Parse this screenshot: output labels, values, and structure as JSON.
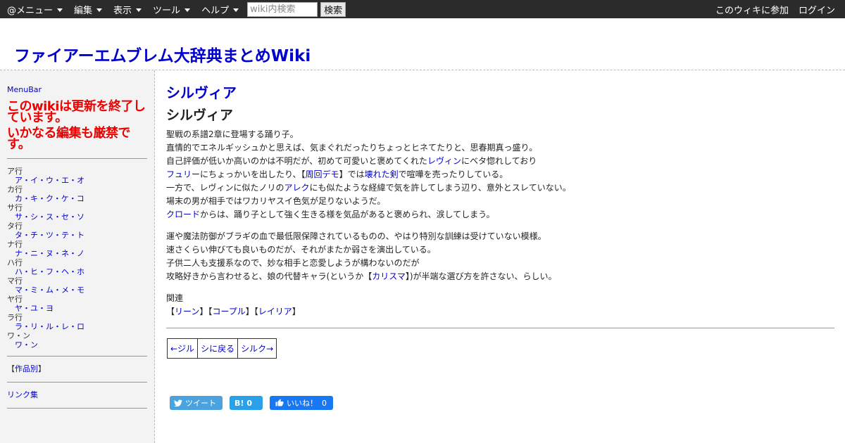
{
  "topbar": {
    "menus": [
      "@メニュー",
      "編集",
      "表示",
      "ツール",
      "ヘルプ"
    ],
    "search_placeholder": "wiki内検索",
    "search_button": "検索",
    "join": "このウィキに参加",
    "login": "ログイン"
  },
  "site_title": "ファイアーエムブレム大辞典まとめWiki",
  "sidebar": {
    "menubar": "MenuBar",
    "warning1": "このwikiは更新を終了しています。",
    "warning2": "いかなる編集も厳禁です。",
    "rows": [
      {
        "head": "ア行",
        "link": "ア・イ・ウ・エ・オ"
      },
      {
        "head": "カ行",
        "link": "カ・キ・ク・ケ・コ"
      },
      {
        "head": "サ行",
        "link": "サ・シ・ス・セ・ソ"
      },
      {
        "head": "タ行",
        "link": "タ・チ・ツ・テ・ト"
      },
      {
        "head": "ナ行",
        "link": "ナ・ニ・ヌ・ネ・ノ"
      },
      {
        "head": "ハ行",
        "link": "ハ・ヒ・フ・ヘ・ホ"
      },
      {
        "head": "マ行",
        "link": "マ・ミ・ム・メ・モ"
      },
      {
        "head": "ヤ行",
        "link": "ヤ・ユ・ヨ"
      },
      {
        "head": "ラ行",
        "link": "ラ・リ・ル・レ・ロ"
      },
      {
        "head": "ワ・ン",
        "link": "ワ・ン"
      }
    ],
    "works_open": "【",
    "works_link": "作品別",
    "works_close": "】",
    "links": "リンク集"
  },
  "main": {
    "page_link": "シルヴィア",
    "heading": "シルヴィア",
    "p1": {
      "l1": "聖戦の系譜2章に登場する踊り子。",
      "l2": "直情的でエネルギッシュかと思えば、気まぐれだったりちょっとヒネてたりと、思春期真っ盛り。",
      "l3a": "自己評価が低いか高いのかは不明だが、初めて可愛いと褒めてくれた",
      "l3link": "レヴィン",
      "l3b": "にベタ惚れしており",
      "l4link1": "フュリー",
      "l4a": "にちょっかいを出したり、【",
      "l4link2": "周回デモ",
      "l4b": "】では",
      "l4link3": "壊れた剣",
      "l4c": "で喧嘩を売ったりしている。",
      "l5a": "一方で、レヴィンに似たノリの",
      "l5link": "アレク",
      "l5b": "にも似たような経緯で気を許してしまう辺り、意外とスレていない。",
      "l6": "場末の男が相手ではワカリヤスイ色気が足りないようだ。",
      "l7link": "クロード",
      "l7a": "からは、踊り子として強く生きる様を気品があると褒められ、涙してしまう。"
    },
    "p2": {
      "l1": "運や魔法防御がブラギの血で最低限保障されているものの、やはり特別な訓練は受けていない模様。",
      "l2": "速さくらい伸びても良いものだが、それがまたか弱さを演出している。",
      "l3": "子供二人も支援系なので、妙な相手と恋愛しようが構わないのだが",
      "l4a": "攻略好きから言わせると、娘の代替キャラ(というか【",
      "l4link": "カリスマ",
      "l4b": "】)が半端な選び方を許さない、らしい。"
    },
    "related": {
      "label": "関連",
      "items": [
        "リーン",
        "コープル",
        "レイリア"
      ]
    },
    "nav": {
      "prev": "←ジル",
      "up": "シに戻る",
      "next": "シルク→"
    },
    "social": {
      "tweet": "ツイート",
      "hatena_icon": "B!",
      "hatena_count": "0",
      "like": "いいね！",
      "like_count": "0"
    }
  }
}
